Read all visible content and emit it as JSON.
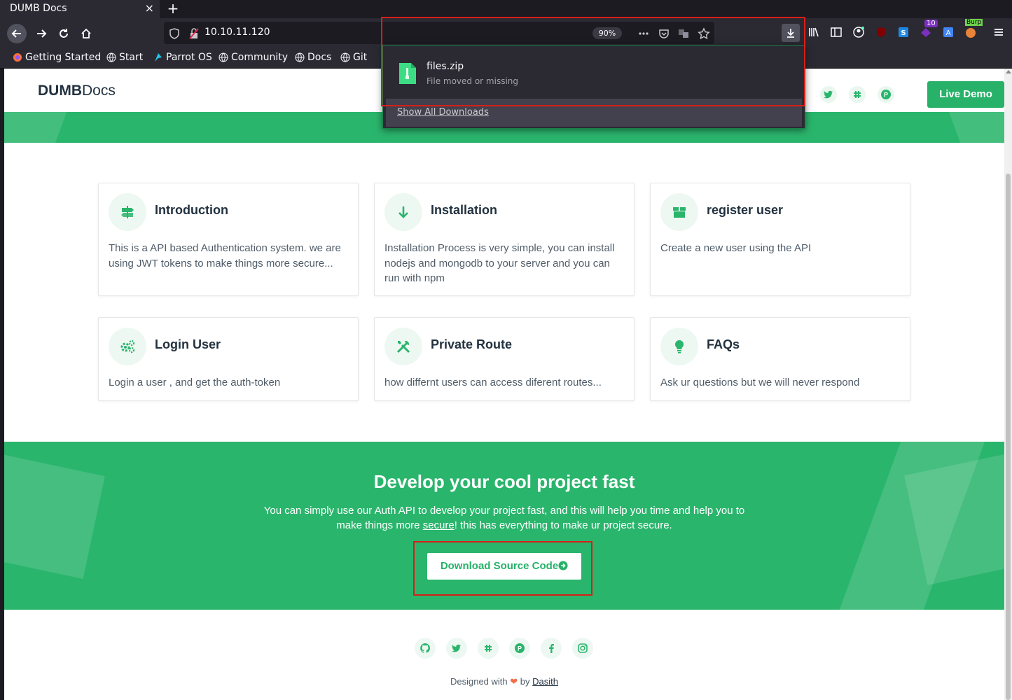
{
  "tab": {
    "title": "DUMB Docs",
    "close": "×",
    "new": "+"
  },
  "urlbar": {
    "url": "10.10.11.120",
    "zoom": "90%"
  },
  "bookmarks": [
    {
      "label": "Getting Started"
    },
    {
      "label": "Start"
    },
    {
      "label": "Parrot OS"
    },
    {
      "label": "Community"
    },
    {
      "label": "Docs"
    },
    {
      "label": "Git"
    }
  ],
  "extensions": {
    "badge_count": "10",
    "burp_label": "Burp"
  },
  "downloads": {
    "file_name": "files.zip",
    "status": "File moved or missing",
    "show_all": "Show All Downloads"
  },
  "site": {
    "logo_bold": "DUMB",
    "logo_light": "Docs",
    "live_demo": "Live Demo"
  },
  "cards": [
    {
      "icon": "signpost-icon",
      "title": "Introduction",
      "text": "This is a API based Authentication system. we are using JWT tokens to make things more secure..."
    },
    {
      "icon": "arrow-down-icon",
      "title": "Installation",
      "text": "Installation Process is very simple, you can install nodejs and mongodb to your server and you can run with npm"
    },
    {
      "icon": "box-icon",
      "title": "register user",
      "text": "Create a new user using the API"
    },
    {
      "icon": "gears-icon",
      "title": "Login User",
      "text": "Login a user , and get the auth-token"
    },
    {
      "icon": "tools-icon",
      "title": "Private Route",
      "text": "how differnt users can access diferent routes..."
    },
    {
      "icon": "lightbulb-icon",
      "title": "FAQs",
      "text": "Ask ur questions but we will never respond"
    }
  ],
  "cta": {
    "title": "Develop your cool project fast",
    "text_before": "You can simply use our Auth API to develop your project fast, and this will help you time and help you to make things more ",
    "text_link": "secure",
    "text_after": "! this has everything to make ur project secure.",
    "button": "Download Source Code"
  },
  "footer": {
    "designed_with": "Designed with",
    "by": "by",
    "author": "Dasith"
  },
  "colors": {
    "brand_green": "#2ab56c",
    "button_green": "#27b169",
    "highlight_red": "#d91e18"
  }
}
